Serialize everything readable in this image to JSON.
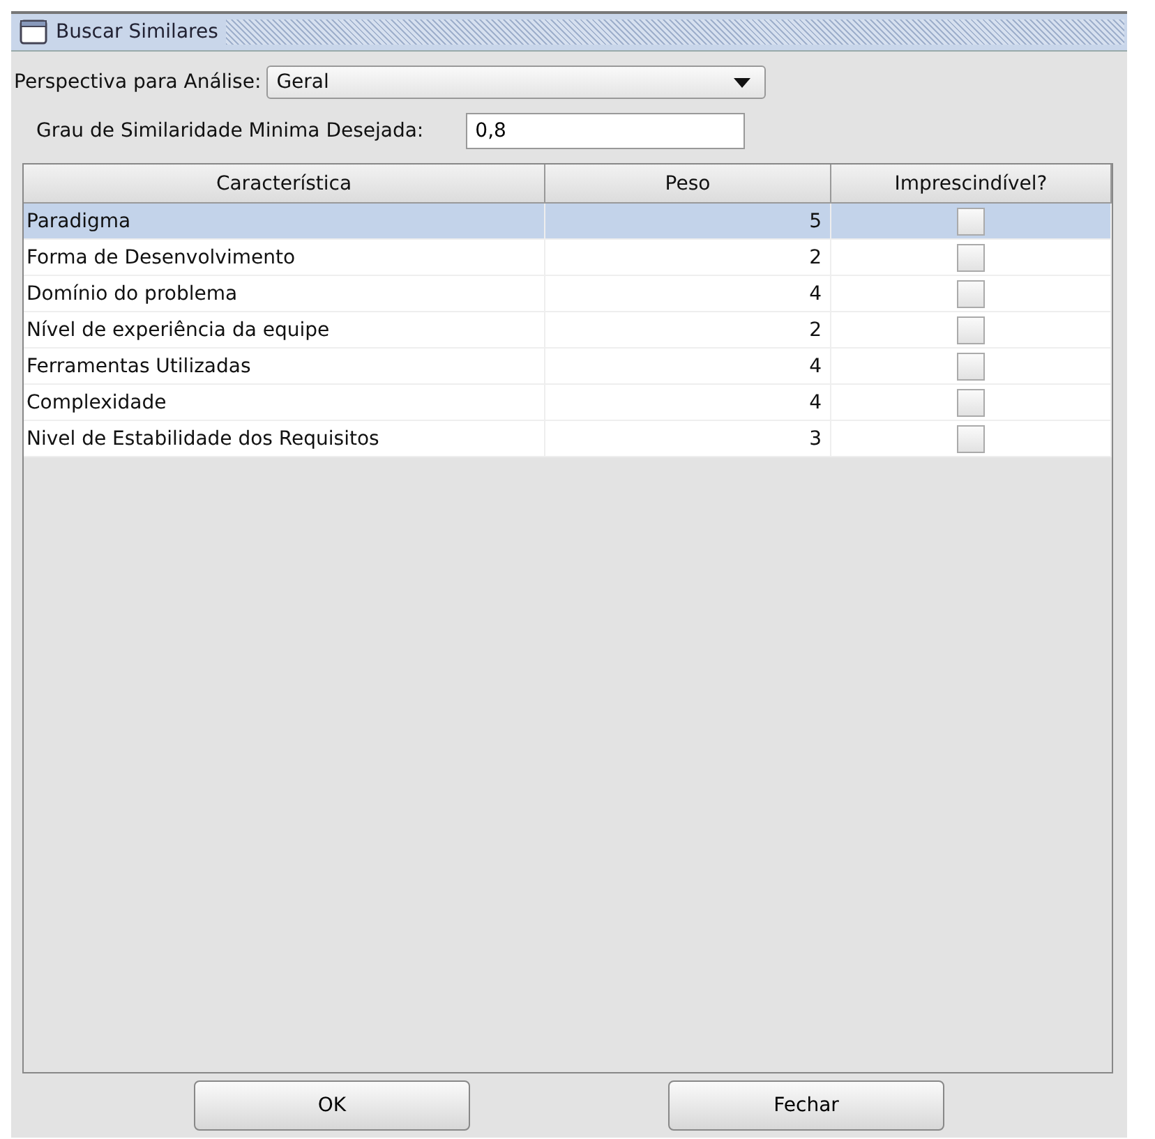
{
  "window": {
    "title": "Buscar Similares"
  },
  "perspective": {
    "label": "Perspectiva para Análise:",
    "value": "Geral"
  },
  "similarity": {
    "label": "Grau de Similaridade Minima Desejada:",
    "value": "0,8"
  },
  "table": {
    "columns": [
      "Característica",
      "Peso",
      "Imprescindível?"
    ],
    "rows": [
      {
        "name": "Paradigma",
        "weight": "5",
        "essential": false,
        "selected": true
      },
      {
        "name": "Forma de Desenvolvimento",
        "weight": "2",
        "essential": false,
        "selected": false
      },
      {
        "name": "Domínio do problema",
        "weight": "4",
        "essential": false,
        "selected": false
      },
      {
        "name": "Nível de experiência da equipe",
        "weight": "2",
        "essential": false,
        "selected": false
      },
      {
        "name": "Ferramentas Utilizadas",
        "weight": "4",
        "essential": false,
        "selected": false
      },
      {
        "name": "Complexidade",
        "weight": "4",
        "essential": false,
        "selected": false
      },
      {
        "name": "Nivel de Estabilidade dos Requisitos",
        "weight": "3",
        "essential": false,
        "selected": false
      }
    ]
  },
  "buttons": [
    "OK",
    "Fechar"
  ]
}
